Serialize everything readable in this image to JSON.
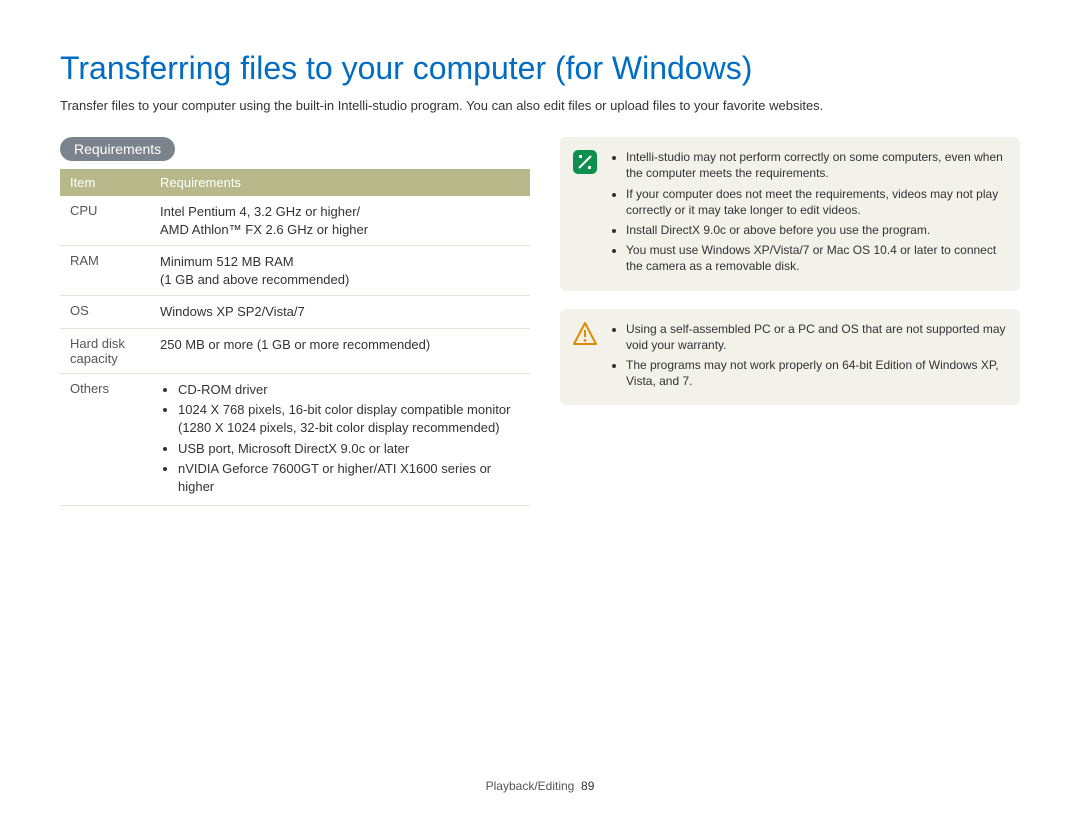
{
  "title": "Transferring files to your computer (for Windows)",
  "intro": "Transfer files to your computer using the built-in Intelli-studio program. You can also edit files or upload files to your favorite websites.",
  "section_label": "Requirements",
  "table": {
    "headers": {
      "item": "Item",
      "req": "Requirements"
    },
    "rows": {
      "cpu": {
        "item": "CPU",
        "line1": "Intel Pentium 4, 3.2 GHz or higher/",
        "line2": "AMD Athlon™ FX 2.6 GHz or higher"
      },
      "ram": {
        "item": "RAM",
        "line1": "Minimum 512 MB RAM",
        "line2": "(1 GB and above recommended)"
      },
      "os": {
        "item": "OS",
        "line1": "Windows XP SP2/Vista/7"
      },
      "hdd": {
        "item": "Hard disk capacity",
        "line1": "250 MB or more (1 GB or more recommended)"
      },
      "others": {
        "item": "Others",
        "b1": "CD-ROM driver",
        "b2": "1024 X 768 pixels, 16-bit color display compatible monitor (1280 X 1024 pixels, 32-bit color display recommended)",
        "b3": "USB port, Microsoft DirectX 9.0c or later",
        "b4": "nVIDIA Geforce 7600GT or higher/ATI X1600 series or higher"
      }
    }
  },
  "note": {
    "b1": "Intelli-studio may not perform correctly on some computers, even when the computer meets the requirements.",
    "b2": "If your computer does not meet the requirements, videos may not play correctly or it may take longer to edit videos.",
    "b3": "Install DirectX 9.0c or above before you use the program.",
    "b4": "You must use Windows XP/Vista/7 or Mac OS 10.4 or later to connect the camera as a removable disk."
  },
  "warn": {
    "b1": "Using a self-assembled PC or a PC and OS that are not supported may void your warranty.",
    "b2": "The programs may not work properly on 64-bit Edition of Windows XP, Vista, and 7."
  },
  "footer": {
    "section": "Playback/Editing",
    "page": "89"
  }
}
